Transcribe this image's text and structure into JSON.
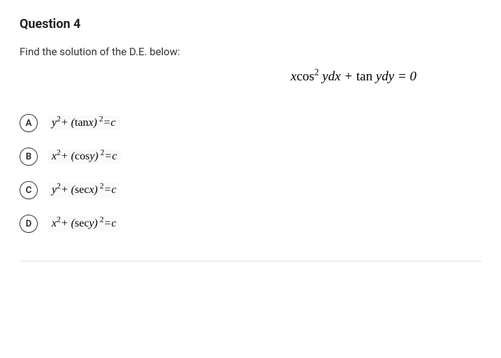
{
  "question": {
    "title": "Question 4",
    "prompt": "Find the solution of the D.E. below:",
    "equation_html": "<span class='it'>x</span><span class='rm'>cos</span><sup>2</sup> <span class='it'>y</span><span class='it'>dx</span> + <span class='rm'>tan</span> <span class='it'>y</span><span class='it'>dy</span> = 0"
  },
  "options": [
    {
      "letter": "A",
      "math_html": "y<sup>2</sup>+ (<span class='rm'>tan</span>x)<sup> 2</sup>=c"
    },
    {
      "letter": "B",
      "math_html": "x<sup>2</sup>+ (<span class='rm'>cos</span>y)<sup> 2</sup>=c"
    },
    {
      "letter": "C",
      "math_html": "y<sup>2</sup>+ (<span class='rm'>sec</span>x)<sup> 2</sup>=c"
    },
    {
      "letter": "D",
      "math_html": "x<sup>2</sup>+ (<span class='rm'>sec</span>y)<sup> 2</sup>=c"
    }
  ]
}
